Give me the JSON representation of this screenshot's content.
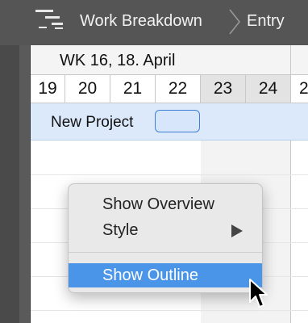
{
  "toolbar": {
    "icon": "work-breakdown-icon",
    "breadcrumb": [
      "Work Breakdown",
      "Entry"
    ],
    "separator_icon": "chevron-right-icon"
  },
  "timeline": {
    "week_label": "WK 16, 18. April",
    "days": [
      "19",
      "20",
      "21",
      "22",
      "23",
      "24",
      "2"
    ],
    "weekend_days": [
      "23",
      "24"
    ]
  },
  "project": {
    "name": "New Project"
  },
  "context_menu": {
    "items": [
      {
        "label": "Show Overview",
        "has_submenu": false
      },
      {
        "label": "Style",
        "has_submenu": true
      },
      {
        "label": "Show Outline",
        "has_submenu": false,
        "highlighted": true
      }
    ],
    "submenu_icon": "triangle-right-icon"
  },
  "colors": {
    "toolbar_bg": "#555555",
    "project_row_bg": "#dbe9fb",
    "highlight": "#4a95e8",
    "weekend_bg": "#e3e3e3"
  }
}
